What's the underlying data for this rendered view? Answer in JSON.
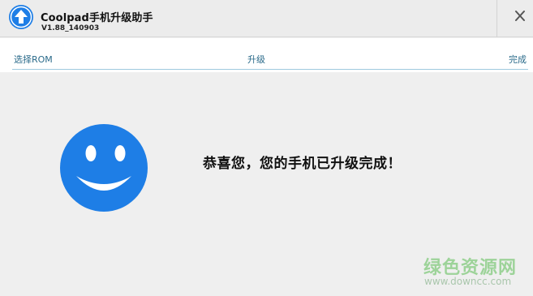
{
  "window": {
    "title": "Coolpad手机升级助手",
    "version": "V1.88_140903"
  },
  "steps": [
    {
      "label": "选择ROM"
    },
    {
      "label": "升级"
    },
    {
      "label": "完成"
    }
  ],
  "main": {
    "message": "恭喜您，您的手机已升级完成！"
  },
  "watermark": {
    "text": "绿色资源网",
    "url": "www.downcc.com"
  },
  "colors": {
    "accent": "#1e7ee6",
    "step_text": "#2a6a8a"
  },
  "icons": {
    "app": "upload-arrow-icon",
    "close": "close-icon",
    "status": "smiley-face-icon"
  }
}
